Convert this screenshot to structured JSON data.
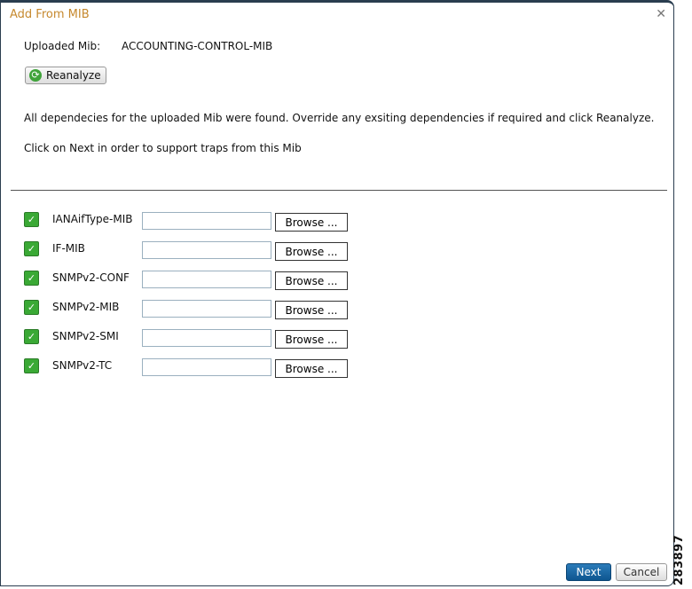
{
  "dialog": {
    "title": "Add From MIB",
    "close_icon": "close-icon"
  },
  "uploaded": {
    "label": "Uploaded Mib:",
    "value": "ACCOUNTING-CONTROL-MIB"
  },
  "reanalyze_label": "Reanalyze",
  "messages": [
    "All dependecies for the uploaded Mib were found. Override any exsiting dependencies if required and click Reanalyze.",
    "Click on Next in order to support traps from this Mib"
  ],
  "dependencies": [
    {
      "name": "IANAifType-MIB",
      "checked": true,
      "path": "",
      "browse": "Browse ..."
    },
    {
      "name": "IF-MIB",
      "checked": true,
      "path": "",
      "browse": "Browse ..."
    },
    {
      "name": "SNMPv2-CONF",
      "checked": true,
      "path": "",
      "browse": "Browse ..."
    },
    {
      "name": "SNMPv2-MIB",
      "checked": true,
      "path": "",
      "browse": "Browse ..."
    },
    {
      "name": "SNMPv2-SMI",
      "checked": true,
      "path": "",
      "browse": "Browse ..."
    },
    {
      "name": "SNMPv2-TC",
      "checked": true,
      "path": "",
      "browse": "Browse ..."
    }
  ],
  "footer": {
    "next": "Next",
    "cancel": "Cancel"
  },
  "figure_id": "283897"
}
